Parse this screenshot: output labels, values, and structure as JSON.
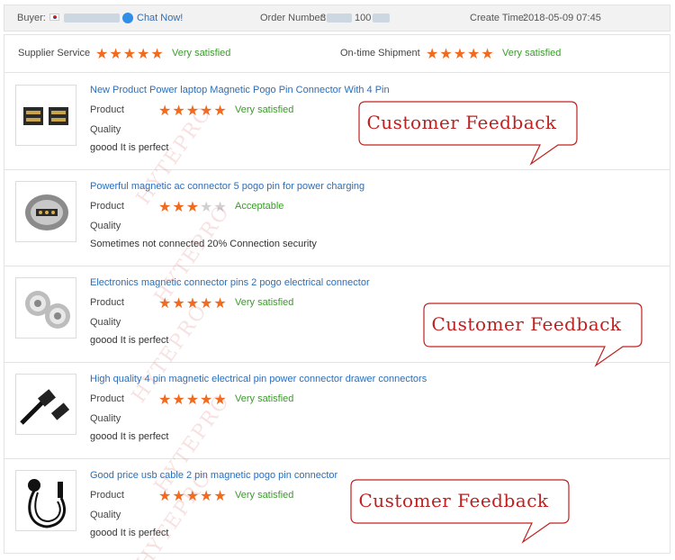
{
  "header": {
    "buyer_label": "Buyer:",
    "chat_label": "Chat Now!",
    "order_label": "Order Number:",
    "order_value_partial": "3",
    "order_value_partial2": "100",
    "create_label": "Create Time:",
    "create_value": "2018-05-09 07:45"
  },
  "summary": {
    "supplier_label": "Supplier Service",
    "supplier_stars": 5,
    "supplier_text": "Very satisfied",
    "shipment_label": "On-time Shipment",
    "shipment_stars": 5,
    "shipment_text": "Very satisfied"
  },
  "labels": {
    "product": "Product",
    "quality": "Quality"
  },
  "rows": [
    {
      "title": "New Product Power laptop Magnetic Pogo Pin Connector With 4 Pin",
      "stars": 5,
      "rating_text": "Very satisfied",
      "comment": "goood It is perfect"
    },
    {
      "title": "Powerful magnetic ac connector 5 pogo pin for power charging",
      "stars": 3,
      "rating_text": "Acceptable",
      "comment": "Sometimes not connected 20% Connection security"
    },
    {
      "title": "Electronics magnetic connector pins 2 pogo electrical connector",
      "stars": 5,
      "rating_text": "Very satisfied",
      "comment": "goood It is perfect"
    },
    {
      "title": "High quality 4 pin magnetic electrical pin power connector drawer connectors",
      "stars": 5,
      "rating_text": "Very satisfied",
      "comment": "goood It is perfect"
    },
    {
      "title": "Good price usb cable 2 pin magnetic pogo pin connector",
      "stars": 5,
      "rating_text": "Very satisfied",
      "comment": "goood It is perfect"
    }
  ],
  "callouts": [
    "Customer Feedback",
    "Customer Feedback",
    "Customer Feedback"
  ],
  "watermark": "HYTEPRO",
  "colors": {
    "star": "#f16a1d",
    "star_off": "#d0d0d0",
    "satisfied": "#3a9b2a",
    "link": "#2a6ebb",
    "callout": "#c0201f"
  }
}
